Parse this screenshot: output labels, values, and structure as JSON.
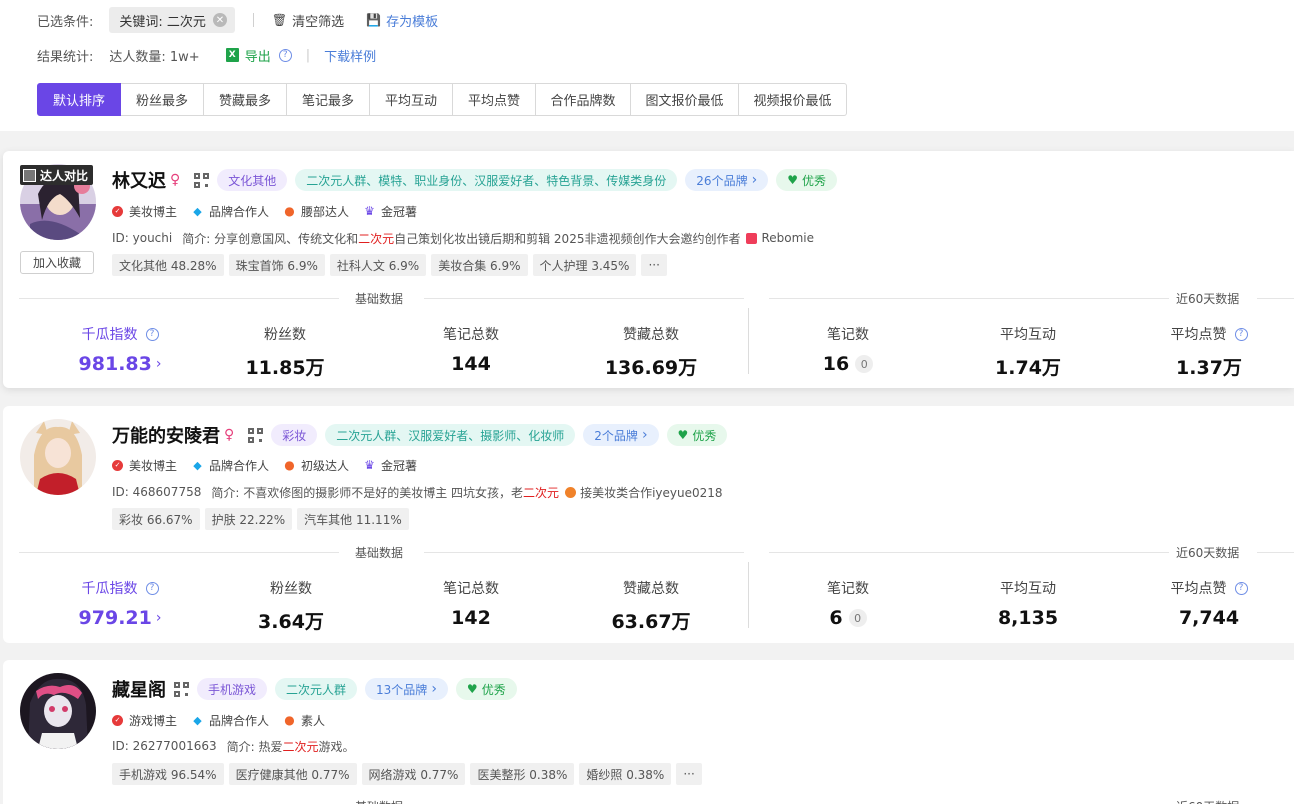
{
  "filters": {
    "selected_label": "已选条件:",
    "keyword_chip": "关键词: 二次元",
    "clear_label": "清空筛选",
    "save_template_label": "存为模板"
  },
  "stats": {
    "label": "结果统计:",
    "count_label": "达人数量: 1w+",
    "export_label": "导出",
    "download_label": "下载样例"
  },
  "sort_options": [
    {
      "label": "默认排序",
      "active": true,
      "w": 84
    },
    {
      "label": "粉丝最多",
      "active": false,
      "w": 83
    },
    {
      "label": "赞藏最多",
      "active": false,
      "w": 83
    },
    {
      "label": "笔记最多",
      "active": false,
      "w": 83
    },
    {
      "label": "平均互动",
      "active": false,
      "w": 83
    },
    {
      "label": "平均点赞",
      "active": false,
      "w": 83
    },
    {
      "label": "合作品牌数",
      "active": false,
      "w": 95
    },
    {
      "label": "图文报价最低",
      "active": false,
      "w": 108
    },
    {
      "label": "视频报价最低",
      "active": false,
      "w": 108
    }
  ],
  "common": {
    "compare_label": "达人对比",
    "favorite_label": "加入收藏",
    "basic_data_label": "基础数据",
    "recent_data_label": "近60天数据",
    "metric_qiangua": "千瓜指数",
    "metric_fans": "粉丝数",
    "metric_notes": "笔记总数",
    "metric_likes_collects": "赞藏总数",
    "metric_recent_notes": "笔记数",
    "metric_avg_interact": "平均互动",
    "metric_avg_likes": "平均点赞",
    "excellent": "优秀"
  },
  "influencers": [
    {
      "name": "林又迟",
      "category_tag": "文化其他",
      "persona_tag": "二次元人群、模特、职业身份、汉服爱好者、特色背景、传媒类身份",
      "brands_tag": "26个品牌",
      "badges": [
        "美妆博主",
        "品牌合作人",
        "腰部达人",
        "金冠薯"
      ],
      "id_text": "ID: youchi",
      "intro_prefix": "简介: 分享创意国风、传统文化和",
      "intro_highlight": "二次元",
      "intro_suffix": " 自己策划化妆出镜后期和剪辑 2025非遗视频创作大会邀约创作者",
      "intro_extra": "Rebomie",
      "categories": [
        "文化其他 48.28%",
        "珠宝首饰 6.9%",
        "社科人文 6.9%",
        "美妆合集 6.9%",
        "个人护理 3.45%",
        "···"
      ],
      "qiangua": "981.83",
      "fans": "11.85万",
      "notes": "144",
      "likes_collects": "136.69万",
      "recent_notes": "16",
      "recent_zero": "0",
      "avg_interact": "1.74万",
      "avg_likes": "1.37万"
    },
    {
      "name": "万能的安陵君",
      "category_tag": "彩妆",
      "persona_tag": "二次元人群、汉服爱好者、摄影师、化妆师",
      "brands_tag": "2个品牌",
      "badges": [
        "美妆博主",
        "品牌合作人",
        "初级达人",
        "金冠薯"
      ],
      "id_text": "ID: 468607758",
      "intro_prefix": "简介: 不喜欢修图的摄影师不是好的美妆博主 四坑女孩，老",
      "intro_highlight": "二次元",
      "intro_suffix": "",
      "intro_extra": "接美妆类合作iyeyue0218",
      "categories": [
        "彩妆 66.67%",
        "护肤 22.22%",
        "汽车其他 11.11%"
      ],
      "qiangua": "979.21",
      "fans": "3.64万",
      "notes": "142",
      "likes_collects": "63.67万",
      "recent_notes": "6",
      "recent_zero": "0",
      "avg_interact": "8,135",
      "avg_likes": "7,744"
    },
    {
      "name": "藏星阁",
      "category_tag": "手机游戏",
      "persona_tag": "二次元人群",
      "brands_tag": "13个品牌",
      "badges": [
        "游戏博主",
        "品牌合作人",
        "素人"
      ],
      "id_text": "ID: 26277001663",
      "intro_prefix": "简介: 热爱",
      "intro_highlight": "二次元",
      "intro_suffix": "游戏。",
      "categories": [
        "手机游戏 96.54%",
        "医疗健康其他 0.77%",
        "网络游戏 0.77%",
        "医美整形 0.38%",
        "婚纱照 0.38%",
        "···"
      ]
    }
  ]
}
